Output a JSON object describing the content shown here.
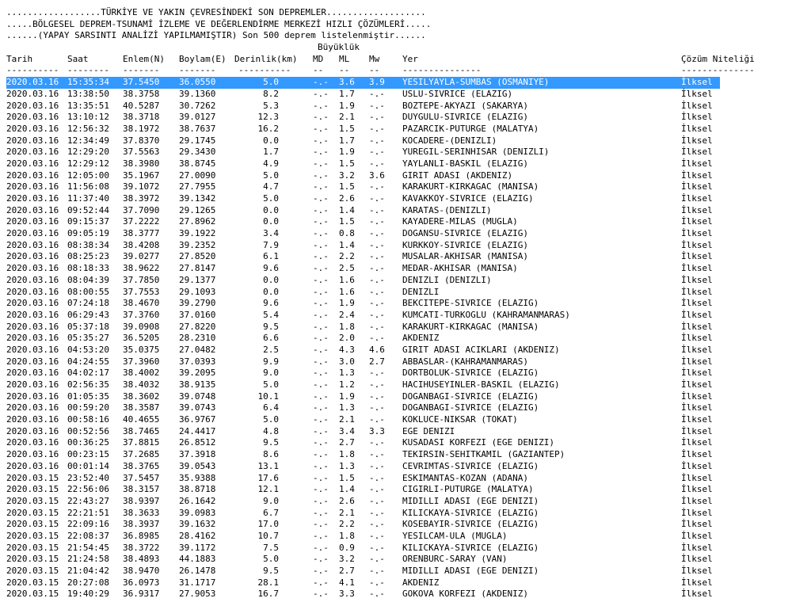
{
  "banner": [
    "..................TÜRKİYE VE YAKIN ÇEVRESİNDEKİ SON DEPREMLER...................",
    ".....BÖLGESEL DEPREM-TSUNAMİ İZLEME VE DEĞERLENDİRME MERKEZİ HIZLI ÇÖZÜMLERİ.....",
    "......(YAPAY SARSINTI ANALİZİ YAPILMAMIŞTIR) Son 500 deprem listelenmiştir......"
  ],
  "magnitude_group_label": "Büyüklük",
  "columns": {
    "date": "Tarih",
    "time": "Saat",
    "lat": "Enlem(N)",
    "lon": "Boylam(E)",
    "depth": "Derinlik(km)",
    "md": "MD",
    "ml": "ML",
    "mw": "Mw",
    "location": "Yer",
    "quality": "Çözüm Niteliği"
  },
  "separators": {
    "date": "----------",
    "time": "--------",
    "lat": "-------",
    "lon": "-------",
    "depth": "----------",
    "md": "--",
    "ml": "--",
    "mw": "--",
    "location": "---------------",
    "quality": "--------------"
  },
  "selected_index": 0,
  "rows": [
    {
      "date": "2020.03.16",
      "time": "15:35:34",
      "lat": "37.5450",
      "lon": "36.0550",
      "depth": "5.0",
      "md": "-.-",
      "ml": "3.6",
      "mw": "3.9",
      "location": "YESILYAYLA-SUMBAS (OSMANIYE)",
      "quality": "İlksel"
    },
    {
      "date": "2020.03.16",
      "time": "13:38:50",
      "lat": "38.3758",
      "lon": "39.1360",
      "depth": "8.2",
      "md": "-.-",
      "ml": "1.7",
      "mw": "-.-",
      "location": "USLU-SIVRICE (ELAZIG)",
      "quality": "İlksel"
    },
    {
      "date": "2020.03.16",
      "time": "13:35:51",
      "lat": "40.5287",
      "lon": "30.7262",
      "depth": "5.3",
      "md": "-.-",
      "ml": "1.9",
      "mw": "-.-",
      "location": "BOZTEPE-AKYAZI (SAKARYA)",
      "quality": "İlksel"
    },
    {
      "date": "2020.03.16",
      "time": "13:10:12",
      "lat": "38.3718",
      "lon": "39.0127",
      "depth": "12.3",
      "md": "-.-",
      "ml": "2.1",
      "mw": "-.-",
      "location": "DUYGULU-SIVRICE (ELAZIG)",
      "quality": "İlksel"
    },
    {
      "date": "2020.03.16",
      "time": "12:56:32",
      "lat": "38.1972",
      "lon": "38.7637",
      "depth": "16.2",
      "md": "-.-",
      "ml": "1.5",
      "mw": "-.-",
      "location": "PAZARCIK-PUTURGE (MALATYA)",
      "quality": "İlksel"
    },
    {
      "date": "2020.03.16",
      "time": "12:34:49",
      "lat": "37.8370",
      "lon": "29.1745",
      "depth": "0.0",
      "md": "-.-",
      "ml": "1.7",
      "mw": "-.-",
      "location": "KOCADERE-(DENIZLI)",
      "quality": "İlksel"
    },
    {
      "date": "2020.03.16",
      "time": "12:29:20",
      "lat": "37.5563",
      "lon": "29.3430",
      "depth": "1.7",
      "md": "-.-",
      "ml": "1.9",
      "mw": "-.-",
      "location": "YUREGIL-SERINHISAR (DENIZLI)",
      "quality": "İlksel"
    },
    {
      "date": "2020.03.16",
      "time": "12:29:12",
      "lat": "38.3980",
      "lon": "38.8745",
      "depth": "4.9",
      "md": "-.-",
      "ml": "1.5",
      "mw": "-.-",
      "location": "YAYLANLI-BASKIL (ELAZIG)",
      "quality": "İlksel"
    },
    {
      "date": "2020.03.16",
      "time": "12:05:00",
      "lat": "35.1967",
      "lon": "27.0090",
      "depth": "5.0",
      "md": "-.-",
      "ml": "3.2",
      "mw": "3.6",
      "location": "GIRIT ADASI (AKDENIZ)",
      "quality": "İlksel"
    },
    {
      "date": "2020.03.16",
      "time": "11:56:08",
      "lat": "39.1072",
      "lon": "27.7955",
      "depth": "4.7",
      "md": "-.-",
      "ml": "1.5",
      "mw": "-.-",
      "location": "KARAKURT-KIRKAGAC (MANISA)",
      "quality": "İlksel"
    },
    {
      "date": "2020.03.16",
      "time": "11:37:40",
      "lat": "38.3972",
      "lon": "39.1342",
      "depth": "5.0",
      "md": "-.-",
      "ml": "2.6",
      "mw": "-.-",
      "location": "KAVAKKOY-SIVRICE (ELAZIG)",
      "quality": "İlksel"
    },
    {
      "date": "2020.03.16",
      "time": "09:52:44",
      "lat": "37.7090",
      "lon": "29.1265",
      "depth": "0.0",
      "md": "-.-",
      "ml": "1.4",
      "mw": "-.-",
      "location": "KARATAS-(DENIZLI)",
      "quality": "İlksel"
    },
    {
      "date": "2020.03.16",
      "time": "09:15:37",
      "lat": "37.2222",
      "lon": "27.8962",
      "depth": "0.0",
      "md": "-.-",
      "ml": "1.5",
      "mw": "-.-",
      "location": "KAYADERE-MILAS (MUGLA)",
      "quality": "İlksel"
    },
    {
      "date": "2020.03.16",
      "time": "09:05:19",
      "lat": "38.3777",
      "lon": "39.1922",
      "depth": "3.4",
      "md": "-.-",
      "ml": "0.8",
      "mw": "-.-",
      "location": "DOGANSU-SIVRICE (ELAZIG)",
      "quality": "İlksel"
    },
    {
      "date": "2020.03.16",
      "time": "08:38:34",
      "lat": "38.4208",
      "lon": "39.2352",
      "depth": "7.9",
      "md": "-.-",
      "ml": "1.4",
      "mw": "-.-",
      "location": "KURKKOY-SIVRICE (ELAZIG)",
      "quality": "İlksel"
    },
    {
      "date": "2020.03.16",
      "time": "08:25:23",
      "lat": "39.0277",
      "lon": "27.8520",
      "depth": "6.1",
      "md": "-.-",
      "ml": "2.2",
      "mw": "-.-",
      "location": "MUSALAR-AKHISAR (MANISA)",
      "quality": "İlksel"
    },
    {
      "date": "2020.03.16",
      "time": "08:18:33",
      "lat": "38.9622",
      "lon": "27.8147",
      "depth": "9.6",
      "md": "-.-",
      "ml": "2.5",
      "mw": "-.-",
      "location": "MEDAR-AKHISAR (MANISA)",
      "quality": "İlksel"
    },
    {
      "date": "2020.03.16",
      "time": "08:04:39",
      "lat": "37.7850",
      "lon": "29.1377",
      "depth": "0.0",
      "md": "-.-",
      "ml": "1.6",
      "mw": "-.-",
      "location": "DENIZLI (DENIZLI)",
      "quality": "İlksel"
    },
    {
      "date": "2020.03.16",
      "time": "08:00:55",
      "lat": "37.7553",
      "lon": "29.1093",
      "depth": "0.0",
      "md": "-.-",
      "ml": "1.6",
      "mw": "-.-",
      "location": "DENIZLI",
      "quality": "İlksel"
    },
    {
      "date": "2020.03.16",
      "time": "07:24:18",
      "lat": "38.4670",
      "lon": "39.2790",
      "depth": "9.6",
      "md": "-.-",
      "ml": "1.9",
      "mw": "-.-",
      "location": "BEKCITEPE-SIVRICE (ELAZIG)",
      "quality": "İlksel"
    },
    {
      "date": "2020.03.16",
      "time": "06:29:43",
      "lat": "37.3760",
      "lon": "37.0160",
      "depth": "5.4",
      "md": "-.-",
      "ml": "2.4",
      "mw": "-.-",
      "location": "KUMCATI-TURKOGLU (KAHRAMANMARAS)",
      "quality": "İlksel"
    },
    {
      "date": "2020.03.16",
      "time": "05:37:18",
      "lat": "39.0908",
      "lon": "27.8220",
      "depth": "9.5",
      "md": "-.-",
      "ml": "1.8",
      "mw": "-.-",
      "location": "KARAKURT-KIRKAGAC (MANISA)",
      "quality": "İlksel"
    },
    {
      "date": "2020.03.16",
      "time": "05:35:27",
      "lat": "36.5205",
      "lon": "28.2310",
      "depth": "6.6",
      "md": "-.-",
      "ml": "2.0",
      "mw": "-.-",
      "location": "AKDENIZ",
      "quality": "İlksel"
    },
    {
      "date": "2020.03.16",
      "time": "04:53:20",
      "lat": "35.0375",
      "lon": "27.0482",
      "depth": "2.5",
      "md": "-.-",
      "ml": "4.3",
      "mw": "4.6",
      "location": "GIRIT ADASI ACIKLARI (AKDENIZ)",
      "quality": "İlksel"
    },
    {
      "date": "2020.03.16",
      "time": "04:24:55",
      "lat": "37.3960",
      "lon": "37.0393",
      "depth": "9.9",
      "md": "-.-",
      "ml": "3.0",
      "mw": "2.7",
      "location": "ABBASLAR-(KAHRAMANMARAS)",
      "quality": "İlksel"
    },
    {
      "date": "2020.03.16",
      "time": "04:02:17",
      "lat": "38.4002",
      "lon": "39.2095",
      "depth": "9.0",
      "md": "-.-",
      "ml": "1.3",
      "mw": "-.-",
      "location": "DORTBOLUK-SIVRICE (ELAZIG)",
      "quality": "İlksel"
    },
    {
      "date": "2020.03.16",
      "time": "02:56:35",
      "lat": "38.4032",
      "lon": "38.9135",
      "depth": "5.0",
      "md": "-.-",
      "ml": "1.2",
      "mw": "-.-",
      "location": "HACIHUSEYINLER-BASKIL (ELAZIG)",
      "quality": "İlksel"
    },
    {
      "date": "2020.03.16",
      "time": "01:05:35",
      "lat": "38.3602",
      "lon": "39.0748",
      "depth": "10.1",
      "md": "-.-",
      "ml": "1.9",
      "mw": "-.-",
      "location": "DOGANBAGI-SIVRICE (ELAZIG)",
      "quality": "İlksel"
    },
    {
      "date": "2020.03.16",
      "time": "00:59:20",
      "lat": "38.3587",
      "lon": "39.0743",
      "depth": "6.4",
      "md": "-.-",
      "ml": "1.3",
      "mw": "-.-",
      "location": "DOGANBAGI-SIVRICE (ELAZIG)",
      "quality": "İlksel"
    },
    {
      "date": "2020.03.16",
      "time": "00:58:16",
      "lat": "40.4655",
      "lon": "36.9767",
      "depth": "5.0",
      "md": "-.-",
      "ml": "2.1",
      "mw": "-.-",
      "location": "KOKLUCE-NIKSAR (TOKAT)",
      "quality": "İlksel"
    },
    {
      "date": "2020.03.16",
      "time": "00:52:56",
      "lat": "38.7465",
      "lon": "24.4417",
      "depth": "4.8",
      "md": "-.-",
      "ml": "3.4",
      "mw": "3.3",
      "location": "EGE DENIZI",
      "quality": "İlksel"
    },
    {
      "date": "2020.03.16",
      "time": "00:36:25",
      "lat": "37.8815",
      "lon": "26.8512",
      "depth": "9.5",
      "md": "-.-",
      "ml": "2.7",
      "mw": "-.-",
      "location": "KUSADASI KORFEZI (EGE DENIZI)",
      "quality": "İlksel"
    },
    {
      "date": "2020.03.16",
      "time": "00:23:15",
      "lat": "37.2685",
      "lon": "37.3918",
      "depth": "8.6",
      "md": "-.-",
      "ml": "1.8",
      "mw": "-.-",
      "location": "TEKIRSIN-SEHITKAMIL (GAZIANTEP)",
      "quality": "İlksel"
    },
    {
      "date": "2020.03.16",
      "time": "00:01:14",
      "lat": "38.3765",
      "lon": "39.0543",
      "depth": "13.1",
      "md": "-.-",
      "ml": "1.3",
      "mw": "-.-",
      "location": "CEVRIMTAS-SIVRICE (ELAZIG)",
      "quality": "İlksel"
    },
    {
      "date": "2020.03.15",
      "time": "23:52:40",
      "lat": "37.5457",
      "lon": "35.9388",
      "depth": "17.6",
      "md": "-.-",
      "ml": "1.5",
      "mw": "-.-",
      "location": "ESKIMANTAS-KOZAN (ADANA)",
      "quality": "İlksel"
    },
    {
      "date": "2020.03.15",
      "time": "22:56:06",
      "lat": "38.3157",
      "lon": "38.8718",
      "depth": "12.1",
      "md": "-.-",
      "ml": "1.4",
      "mw": "-.-",
      "location": "CIGIRLI-PUTURGE (MALATYA)",
      "quality": "İlksel"
    },
    {
      "date": "2020.03.15",
      "time": "22:43:27",
      "lat": "38.9397",
      "lon": "26.1642",
      "depth": "9.0",
      "md": "-.-",
      "ml": "2.6",
      "mw": "-.-",
      "location": "MIDILLI ADASI (EGE DENIZI)",
      "quality": "İlksel"
    },
    {
      "date": "2020.03.15",
      "time": "22:21:51",
      "lat": "38.3633",
      "lon": "39.0983",
      "depth": "6.7",
      "md": "-.-",
      "ml": "2.1",
      "mw": "-.-",
      "location": "KILICKAYA-SIVRICE (ELAZIG)",
      "quality": "İlksel"
    },
    {
      "date": "2020.03.15",
      "time": "22:09:16",
      "lat": "38.3937",
      "lon": "39.1632",
      "depth": "17.0",
      "md": "-.-",
      "ml": "2.2",
      "mw": "-.-",
      "location": "KOSEBAYIR-SIVRICE (ELAZIG)",
      "quality": "İlksel"
    },
    {
      "date": "2020.03.15",
      "time": "22:08:37",
      "lat": "36.8985",
      "lon": "28.4162",
      "depth": "10.7",
      "md": "-.-",
      "ml": "1.8",
      "mw": "-.-",
      "location": "YESILCAM-ULA (MUGLA)",
      "quality": "İlksel"
    },
    {
      "date": "2020.03.15",
      "time": "21:54:45",
      "lat": "38.3722",
      "lon": "39.1172",
      "depth": "7.5",
      "md": "-.-",
      "ml": "0.9",
      "mw": "-.-",
      "location": "KILICKAYA-SIVRICE (ELAZIG)",
      "quality": "İlksel"
    },
    {
      "date": "2020.03.15",
      "time": "21:24:58",
      "lat": "38.4893",
      "lon": "44.1883",
      "depth": "5.0",
      "md": "-.-",
      "ml": "3.2",
      "mw": "-.-",
      "location": "ORENBURC-SARAY (VAN)",
      "quality": "İlksel"
    },
    {
      "date": "2020.03.15",
      "time": "21:04:42",
      "lat": "38.9470",
      "lon": "26.1478",
      "depth": "9.5",
      "md": "-.-",
      "ml": "2.7",
      "mw": "-.-",
      "location": "MIDILLI ADASI (EGE DENIZI)",
      "quality": "İlksel"
    },
    {
      "date": "2020.03.15",
      "time": "20:27:08",
      "lat": "36.0973",
      "lon": "31.1717",
      "depth": "28.1",
      "md": "-.-",
      "ml": "4.1",
      "mw": "-.-",
      "location": "AKDENIZ",
      "quality": "İlksel"
    },
    {
      "date": "2020.03.15",
      "time": "19:40:29",
      "lat": "36.9317",
      "lon": "27.9053",
      "depth": "16.7",
      "md": "-.-",
      "ml": "3.3",
      "mw": "-.-",
      "location": "GOKOVA KORFEZI (AKDENIZ)",
      "quality": "İlksel"
    }
  ]
}
